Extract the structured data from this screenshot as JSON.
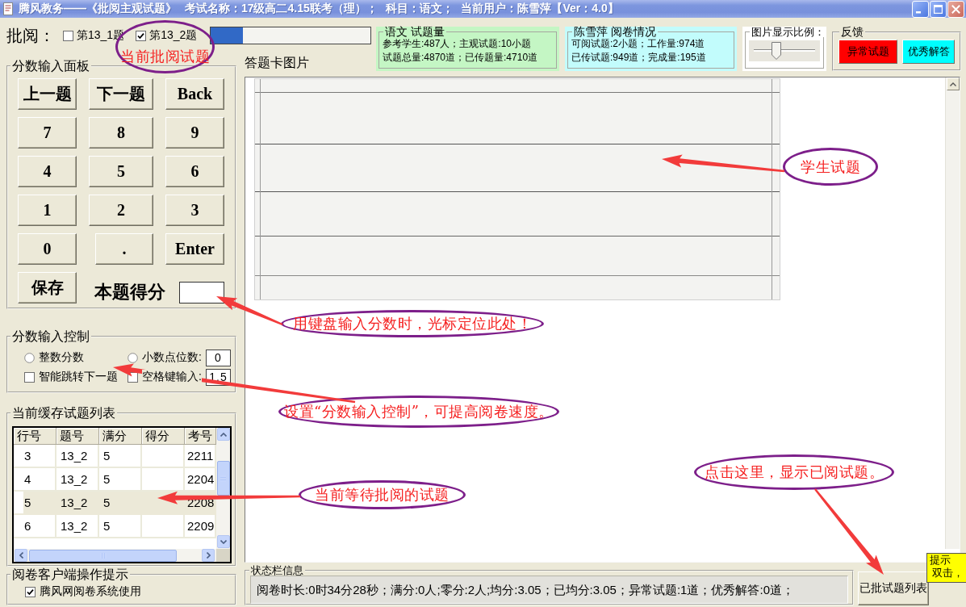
{
  "window": {
    "title": "腾风教务——《批阅主观试题》 考试名称：17级高二4.15联考（理）； 科目：语文； 当前用户：陈雪萍【Ver：4.0】"
  },
  "review_bar": {
    "label": "批阅：",
    "questions": [
      {
        "label": "第13_1题",
        "checked": false
      },
      {
        "label": "第13_2题",
        "checked": true
      }
    ],
    "progress": {
      "level": 0.2
    }
  },
  "info_panels": [
    {
      "title": "语文 试题量",
      "color": "#c4f6c4",
      "lines": [
        "参考学生:487人；主观试题:10小题",
        "试题总量:4870道；已传题量:4710道"
      ]
    },
    {
      "title": "陈雪萍 阅卷情况",
      "color": "#c2fcfc",
      "lines": [
        "可阅试题:2小题；工作量:974道",
        "已传试题:949道；完成量:195道"
      ]
    }
  ],
  "zoom": {
    "title": "图片显示比例：",
    "slider": {
      "level": 0.35
    }
  },
  "feedback": {
    "title": "反馈",
    "buttons": [
      {
        "label": "异常试题",
        "color": "#ff0000"
      },
      {
        "label": "优秀解答",
        "color": "#00ffff"
      }
    ]
  },
  "score_panel": {
    "title": "分数输入面板",
    "keys": [
      "上一题",
      "下一题",
      "Back",
      "7",
      "8",
      "9",
      "4",
      "5",
      "6",
      "1",
      "2",
      "3",
      "0",
      ".",
      "Enter"
    ],
    "save_button": "保存",
    "score_label": "本题得分"
  },
  "score_control": {
    "title": "分数输入控制",
    "options": [
      {
        "kind": "radio",
        "label": "整数分数",
        "selected": false
      },
      {
        "kind": "radio",
        "label": "小数点位数:",
        "selected": false,
        "value": "0"
      },
      {
        "kind": "checkbox",
        "label": "智能跳转下一题",
        "checked": false
      },
      {
        "kind": "checkbox",
        "label": "空格键输入:",
        "checked": false,
        "value": "1.5"
      }
    ]
  },
  "cache_list": {
    "title": "当前缓存试题列表",
    "columns": [
      "行号",
      "题号",
      "满分",
      "得分",
      "考号"
    ],
    "rows": [
      {
        "cells": [
          "3",
          "13_2",
          "5",
          null,
          "2211"
        ],
        "selected": false
      },
      {
        "cells": [
          "4",
          "13_2",
          "5",
          null,
          "2204"
        ],
        "selected": false
      },
      {
        "cells": [
          "5",
          "13_2",
          "5",
          null,
          "2208"
        ],
        "selected": true
      },
      {
        "cells": [
          "6",
          "13_2",
          "5",
          null,
          "2209"
        ],
        "selected": false
      }
    ]
  },
  "client_tips": {
    "title": "阅卷客户端操作提示",
    "options": [
      {
        "label": "腾风网阅卷系统使用",
        "checked": true
      }
    ]
  },
  "image_panel": {
    "title": "答题卡图片"
  },
  "status_bar": {
    "title": "状态栏信息",
    "text": "阅卷时长:0时34分28秒；满分:0人;零分:2人;均分:3.05；已均分:3.05；异常试题:1道；优秀解答:0道；"
  },
  "reviewed_list_button": {
    "label": "已批试题列表"
  },
  "tooltip": {
    "title": "提示",
    "text": "双击，"
  },
  "annotations": [
    {
      "text": "当前批阅试题"
    },
    {
      "text": "学生试题"
    },
    {
      "text": "用键盘输入分数时，光标定位此处！"
    },
    {
      "text": "设置“分数输入控制”，可提高阅卷速度。"
    },
    {
      "text": "当前等待批阅的试题"
    },
    {
      "text": "点击这里，显示已阅试题。"
    }
  ]
}
